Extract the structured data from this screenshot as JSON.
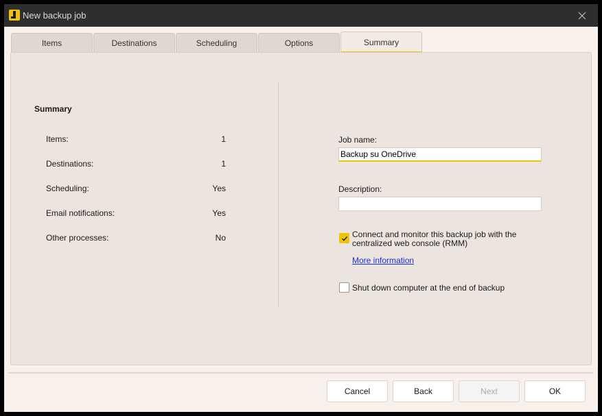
{
  "window": {
    "title": "New backup job"
  },
  "tabs": [
    {
      "label": "Items"
    },
    {
      "label": "Destinations"
    },
    {
      "label": "Scheduling"
    },
    {
      "label": "Options"
    },
    {
      "label": "Summary",
      "active": true
    }
  ],
  "summary": {
    "title": "Summary",
    "rows": [
      {
        "label": "Items:",
        "value": "1"
      },
      {
        "label": "Destinations:",
        "value": "1"
      },
      {
        "label": "Scheduling:",
        "value": "Yes"
      },
      {
        "label": "Email notifications:",
        "value": "Yes"
      },
      {
        "label": "Other processes:",
        "value": "No"
      }
    ]
  },
  "job": {
    "name_label": "Job name:",
    "name_value": "Backup su OneDrive",
    "description_label": "Description:",
    "description_value": ""
  },
  "options": {
    "rmm_label": "Connect and monitor this backup job with the centralized web console (RMM)",
    "rmm_checked": true,
    "more_info_link": "More information",
    "shutdown_label": "Shut down computer at the end of backup",
    "shutdown_checked": false
  },
  "buttons": {
    "cancel": "Cancel",
    "back": "Back",
    "next": "Next",
    "ok": "OK"
  },
  "colors": {
    "accent": "#f2c400",
    "titlebar": "#2e2e2e",
    "panel": "#ebe4df",
    "link": "#1a2fd6"
  },
  "icons": {
    "app": "app-logo-icon",
    "close": "close-icon",
    "check": "checkmark-icon"
  }
}
